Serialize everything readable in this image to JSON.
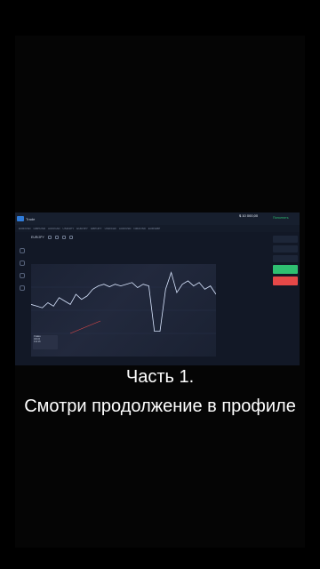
{
  "app": {
    "brand": "Trade",
    "balance_label": "$ 10 000,00",
    "deposit_label": "Пополнить"
  },
  "tabs": [
    "EUR/USD",
    "GBP/USD",
    "AUD/CAD",
    "USD/JPY",
    "EUR/JPY",
    "GBP/JPY",
    "USD/CHF",
    "AUD/USD",
    "NZD/USD",
    "EUR/GBP"
  ],
  "asset": {
    "name": "EUR/JPY"
  },
  "chart_data": {
    "type": "line",
    "series": [
      {
        "values": [
          62,
          60,
          58,
          64,
          60,
          70,
          66,
          62,
          74,
          68,
          72,
          80,
          84,
          86,
          83,
          86,
          84,
          86,
          88,
          82,
          86,
          84,
          30,
          30,
          80,
          100,
          76,
          86,
          90,
          84,
          88,
          80,
          84,
          74
        ]
      }
    ]
  },
  "info": {
    "line1": "Ставка",
    "line2": "100,00",
    "line3": "0:11:26"
  },
  "captions": {
    "part": "Часть 1.",
    "more": "Смотри продолжение в профиле"
  }
}
